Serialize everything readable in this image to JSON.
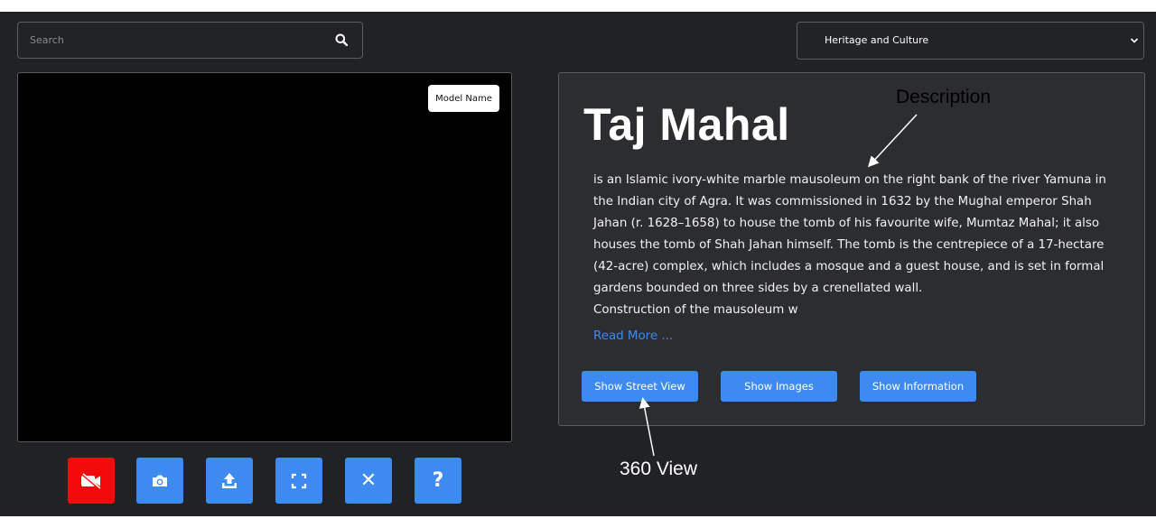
{
  "search": {
    "placeholder": "Search",
    "icon": "search-icon"
  },
  "category_select": {
    "selected": "Heritage and Culture"
  },
  "viewer": {
    "model_name_label": "Model Name"
  },
  "toolbar": {
    "buttons": [
      {
        "name": "camera-off",
        "icon": "video-off-icon",
        "color": "#f40a0a"
      },
      {
        "name": "snapshot",
        "icon": "camera-icon",
        "color": "#3d8bf0"
      },
      {
        "name": "upload",
        "icon": "upload-icon",
        "color": "#3d8bf0"
      },
      {
        "name": "fullscreen",
        "icon": "fullscreen-icon",
        "color": "#3d8bf0"
      },
      {
        "name": "close",
        "icon": "close-icon",
        "glyph": "✕",
        "color": "#3d8bf0"
      },
      {
        "name": "help",
        "icon": "help-icon",
        "glyph": "?",
        "color": "#3d8bf0"
      }
    ]
  },
  "info": {
    "title": "Taj Mahal",
    "description": "is an Islamic ivory-white marble mausoleum on the right bank of the river Yamuna in\nthe Indian city of Agra. It was commissioned in 1632 by the Mughal emperor Shah\nJahan (r. 1628–1658) to house the tomb of his favourite wife, Mumtaz Mahal; it also\nhouses the tomb of Shah Jahan himself. The tomb is the centrepiece of a 17-hectare\n(42-acre) complex, which includes a mosque and a guest house, and is set in formal\ngardens bounded on three sides by a crenellated wall.\nConstruction of the mausoleum w",
    "read_more": "Read More ...",
    "buttons": {
      "street_view": "Show Street View",
      "images": "Show Images",
      "information": "Show Information"
    }
  },
  "annotations": {
    "description": "Description",
    "view_360": "360 View"
  },
  "colors": {
    "accent": "#3d8bf0",
    "danger": "#f40a0a",
    "background": "#212225",
    "panel": "#2c2d30"
  }
}
